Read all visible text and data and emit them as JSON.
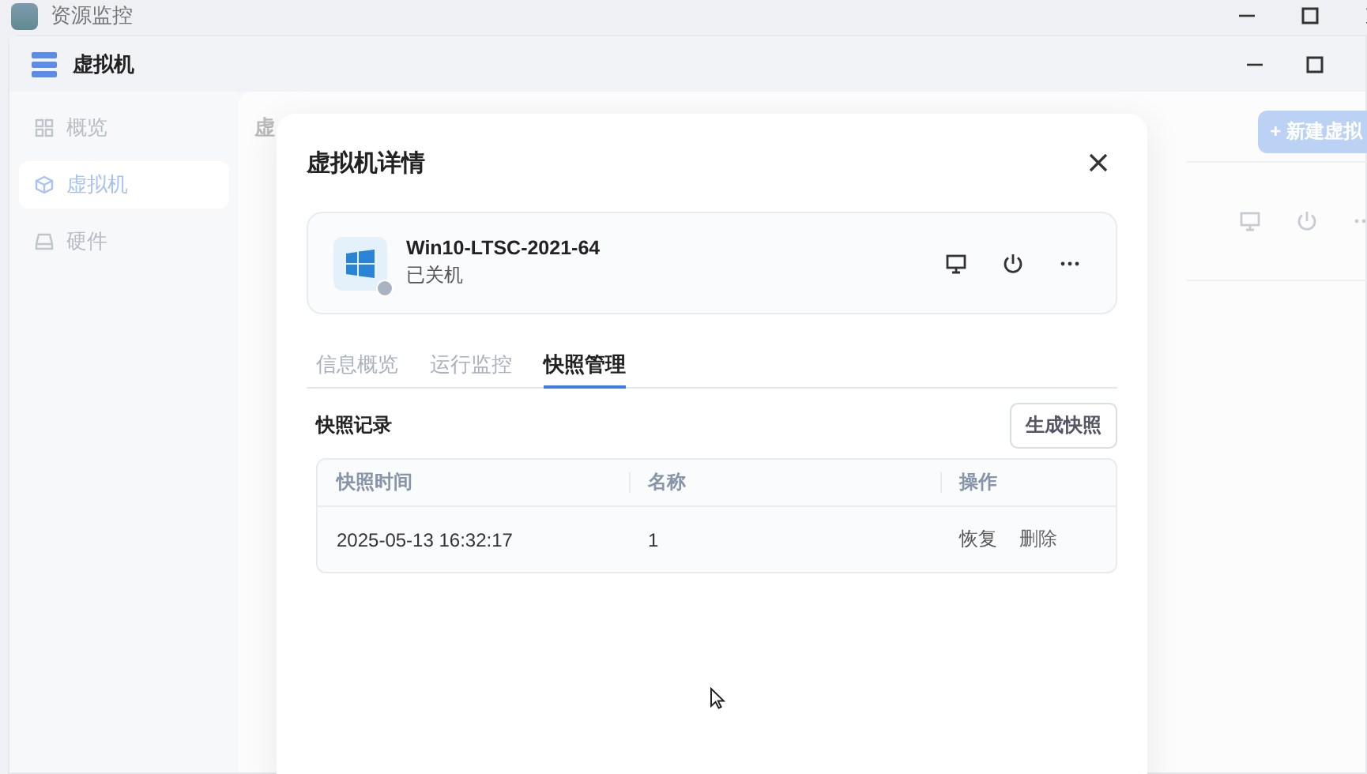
{
  "app": {
    "title": "资源监控"
  },
  "window": {
    "title": "虚拟机"
  },
  "sidebar": {
    "items": [
      {
        "label": "概览",
        "selected": false
      },
      {
        "label": "虚拟机",
        "selected": true
      },
      {
        "label": "硬件",
        "selected": false
      }
    ]
  },
  "background": {
    "heading_fragment": "虚",
    "new_button": "+ 新建虚拟"
  },
  "dialog": {
    "title": "虚拟机详情",
    "vm": {
      "name": "Win10-LTSC-2021-64",
      "status": "已关机",
      "running": false
    },
    "tabs": [
      {
        "label": "信息概览",
        "selected": false
      },
      {
        "label": "运行监控",
        "selected": false
      },
      {
        "label": "快照管理",
        "selected": true
      }
    ],
    "section_title": "快照记录",
    "create_button": "生成快照",
    "table": {
      "columns": [
        "快照时间",
        "名称",
        "操作"
      ],
      "rows": [
        {
          "time": "2025-05-13 16:32:17",
          "name": "1",
          "actions": [
            "恢复",
            "删除"
          ]
        }
      ]
    }
  }
}
